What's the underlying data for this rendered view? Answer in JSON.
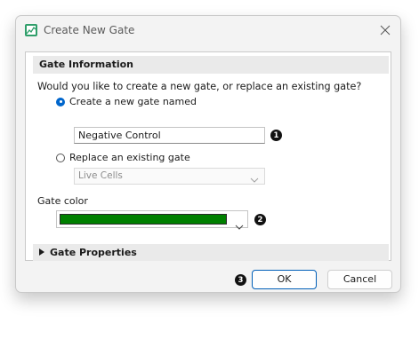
{
  "window": {
    "title": "Create New Gate",
    "icon": "chart-icon",
    "close_icon": "close-icon"
  },
  "section": {
    "header": "Gate Information",
    "question": "Would you like to create a new gate, or replace an existing gate?"
  },
  "options": {
    "create_new": {
      "label": "Create a new gate named",
      "selected": true
    },
    "name_value": "Negative Control",
    "replace_existing": {
      "label": "Replace an existing gate",
      "selected": false
    },
    "existing_gate_value": "Live Cells"
  },
  "gate_color": {
    "label": "Gate color",
    "value": "#008000"
  },
  "properties": {
    "label": "Gate Properties",
    "expanded": false
  },
  "markers": {
    "one": "1",
    "two": "2",
    "three": "3"
  },
  "buttons": {
    "ok": "OK",
    "cancel": "Cancel"
  },
  "colors": {
    "accent": "#0066cc",
    "default_button_border": "#005fb8",
    "section_header_bg": "#eaeaea"
  }
}
